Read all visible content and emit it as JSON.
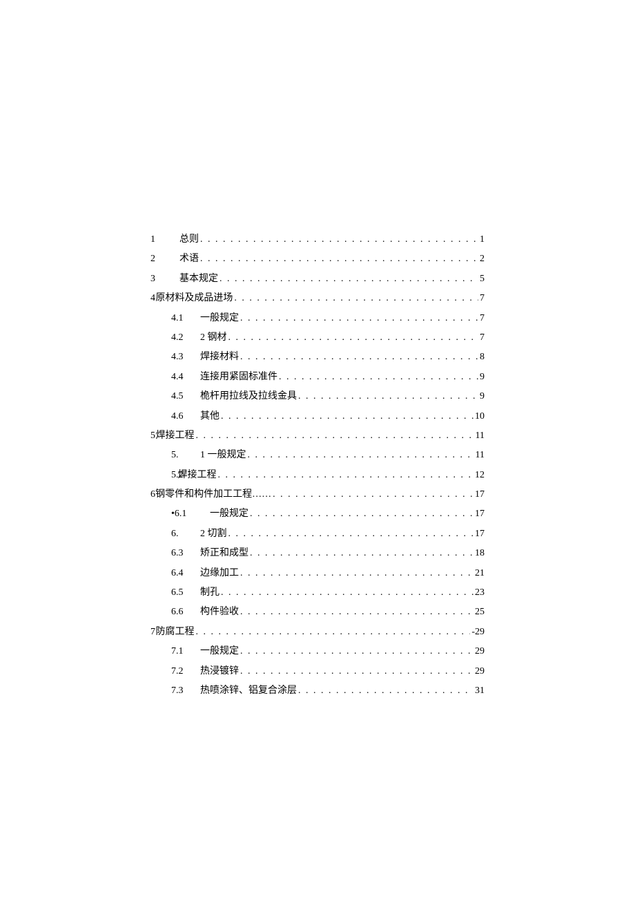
{
  "toc": [
    {
      "indent": "indent-0",
      "prefix": "1",
      "prefixCls": "wide",
      "label": "总则",
      "page": "1"
    },
    {
      "indent": "indent-0",
      "prefix": "2",
      "prefixCls": "wide",
      "label": "术语",
      "page": "2"
    },
    {
      "indent": "indent-0",
      "prefix": "3",
      "prefixCls": "wide",
      "label": "基本规定",
      "page": "5"
    },
    {
      "indent": "indent-0",
      "prefix": "4",
      "prefixCls": "narrow",
      "label": "原材料及成品进场",
      "page": "7"
    },
    {
      "indent": "indent-1",
      "prefix": "4.1",
      "prefixCls": "wide",
      "label": "一般规定",
      "page": "7"
    },
    {
      "indent": "indent-1",
      "prefix": "4.2",
      "prefixCls": "wide",
      "label": "2 钢材",
      "page": "7"
    },
    {
      "indent": "indent-1",
      "prefix": "4.3",
      "prefixCls": "wide",
      "label": "焊接材料",
      "page": "8"
    },
    {
      "indent": "indent-1",
      "prefix": "4.4",
      "prefixCls": "wide",
      "label": "连接用紧固标准件",
      "page": "9"
    },
    {
      "indent": "indent-1",
      "prefix": "4.5",
      "prefixCls": "wide",
      "label": "桅杆用拉线及拉线金具",
      "page": "9"
    },
    {
      "indent": "indent-1",
      "prefix": "4.6",
      "prefixCls": "wide",
      "label": "其他",
      "page": "10"
    },
    {
      "indent": "indent-0",
      "prefix": "5",
      "prefixCls": "narrow",
      "label": "焊接工程",
      "page": "11"
    },
    {
      "indent": "indent-1",
      "prefix": "5.",
      "prefixCls": "wide",
      "label": "1 一般规定",
      "page": "11"
    },
    {
      "indent": "indent-1b",
      "prefix": "5.2",
      "prefixCls": "narrow",
      "label": "焊接工程",
      "page": "12"
    },
    {
      "indent": "indent-0",
      "prefix": "6",
      "prefixCls": "narrow",
      "label": "钢零件和构件加工工程……",
      "page": "17"
    },
    {
      "indent": "indent-1",
      "prefix": "•6.1",
      "prefixCls": "wide",
      "label": "　一般规定",
      "page": "17"
    },
    {
      "indent": "indent-1",
      "prefix": "6.",
      "prefixCls": "wide",
      "label": "2 切割",
      "page": "17"
    },
    {
      "indent": "indent-1",
      "prefix": "6.3",
      "prefixCls": "wide",
      "label": "矫正和成型",
      "page": "18"
    },
    {
      "indent": "indent-1",
      "prefix": "6.4",
      "prefixCls": "wide",
      "label": "边缘加工",
      "page": "21"
    },
    {
      "indent": "indent-1",
      "prefix": "6.5",
      "prefixCls": "wide",
      "label": "制孔",
      "page": "23"
    },
    {
      "indent": "indent-1",
      "prefix": "6.6",
      "prefixCls": "wide",
      "label": "构件验收",
      "page": "25"
    },
    {
      "indent": "indent-0",
      "prefix": "7",
      "prefixCls": "narrow",
      "label": "防腐工程",
      "page": "-29"
    },
    {
      "indent": "indent-1",
      "prefix": "7.1",
      "prefixCls": "wide",
      "label": "一般规定",
      "page": "29"
    },
    {
      "indent": "indent-1",
      "prefix": "7.2",
      "prefixCls": "wide",
      "label": "热浸镀锌",
      "page": "29"
    },
    {
      "indent": "indent-1",
      "prefix": "7.3",
      "prefixCls": "wide",
      "label": "热喷涂锌、铝复合涂层",
      "page": "31"
    }
  ]
}
